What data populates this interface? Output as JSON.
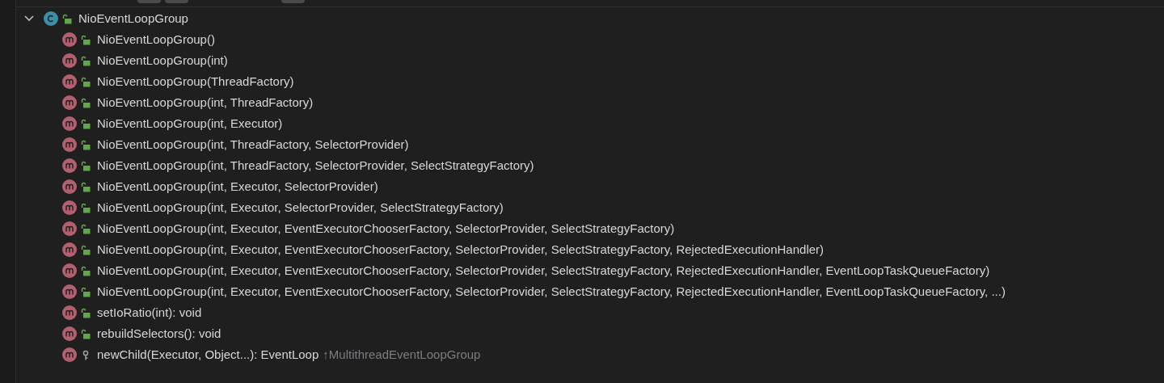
{
  "tree": {
    "label": "NioEventLoopGroup",
    "kind": "class",
    "protected": false,
    "expanded": true,
    "children": [
      {
        "label": "NioEventLoopGroup()",
        "kind": "method",
        "protected": false
      },
      {
        "label": "NioEventLoopGroup(int)",
        "kind": "method",
        "protected": false
      },
      {
        "label": "NioEventLoopGroup(ThreadFactory)",
        "kind": "method",
        "protected": false
      },
      {
        "label": "NioEventLoopGroup(int, ThreadFactory)",
        "kind": "method",
        "protected": false
      },
      {
        "label": "NioEventLoopGroup(int, Executor)",
        "kind": "method",
        "protected": false
      },
      {
        "label": "NioEventLoopGroup(int, ThreadFactory, SelectorProvider)",
        "kind": "method",
        "protected": false
      },
      {
        "label": "NioEventLoopGroup(int, ThreadFactory, SelectorProvider, SelectStrategyFactory)",
        "kind": "method",
        "protected": false
      },
      {
        "label": "NioEventLoopGroup(int, Executor, SelectorProvider)",
        "kind": "method",
        "protected": false
      },
      {
        "label": "NioEventLoopGroup(int, Executor, SelectorProvider, SelectStrategyFactory)",
        "kind": "method",
        "protected": false
      },
      {
        "label": "NioEventLoopGroup(int, Executor, EventExecutorChooserFactory, SelectorProvider, SelectStrategyFactory)",
        "kind": "method",
        "protected": false
      },
      {
        "label": "NioEventLoopGroup(int, Executor, EventExecutorChooserFactory, SelectorProvider, SelectStrategyFactory, RejectedExecutionHandler)",
        "kind": "method",
        "protected": false
      },
      {
        "label": "NioEventLoopGroup(int, Executor, EventExecutorChooserFactory, SelectorProvider, SelectStrategyFactory, RejectedExecutionHandler, EventLoopTaskQueueFactory)",
        "kind": "method",
        "protected": false
      },
      {
        "label": "NioEventLoopGroup(int, Executor, EventExecutorChooserFactory, SelectorProvider, SelectStrategyFactory, RejectedExecutionHandler, EventLoopTaskQueueFactory, ...)",
        "kind": "method",
        "protected": false
      },
      {
        "label": "setIoRatio(int): void",
        "kind": "method",
        "protected": false
      },
      {
        "label": "rebuildSelectors(): void",
        "kind": "method",
        "protected": false
      },
      {
        "label": "newChild(Executor, Object...): EventLoop",
        "kind": "method",
        "protected": true,
        "inherited_from": "↑MultithreadEventLoopGroup"
      }
    ]
  }
}
